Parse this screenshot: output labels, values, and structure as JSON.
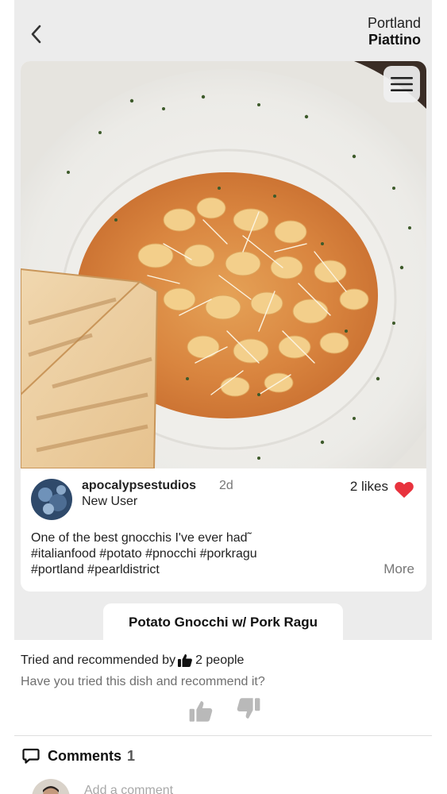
{
  "header": {
    "back_icon": "chevron-left-icon",
    "city": "Portland",
    "restaurant": "Piattino"
  },
  "post": {
    "menu_icon": "hamburger-menu-icon",
    "user": {
      "name": "apocalypsestudios",
      "time": "2d",
      "role": "New User"
    },
    "likes": "2 likes",
    "heart_color": "#e8323d",
    "caption": [
      "One of the best gnocchis I've ever had˜",
      "#italianfood #potato #pnocchi #porkragu",
      "#portland #pearldistrict"
    ],
    "more": "More"
  },
  "dish": {
    "name": "Potato Gnocchi w/ Pork Ragu"
  },
  "recommend": {
    "prefix": "Tried and recommended by",
    "count": "2 people",
    "question": "Have you tried this dish and recommend it?",
    "up_icon": "thumbs-up-icon",
    "down_icon": "thumbs-down-icon"
  },
  "comments": {
    "label": "Comments",
    "count": "1",
    "input_placeholder": "Add a comment"
  }
}
